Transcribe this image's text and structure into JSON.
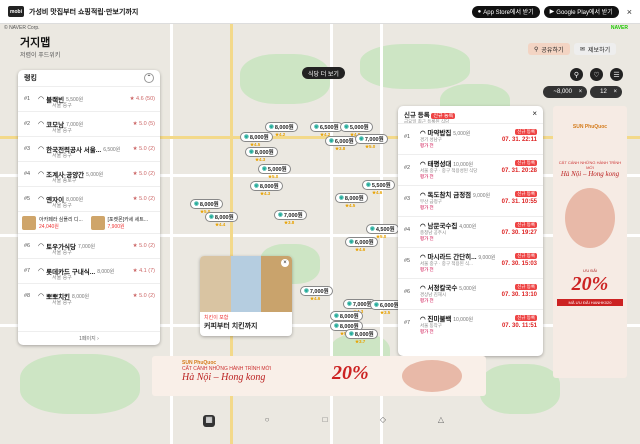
{
  "topbar": {
    "logo": "mobi",
    "promo": "가성비 맛집부터 쇼핑적립·만보기까지",
    "appstore": "App Store에서 받기",
    "googleplay": "Google Play에서 받기",
    "close": "×"
  },
  "header": {
    "copyright": "© NAVER Corp.",
    "naver": "NAVER",
    "title": "거지맵",
    "subtitle": "저렴이 푸드위키",
    "share_label": "공유하기",
    "report_label": "제보하기"
  },
  "map_actions": {
    "view_restaurants": "식당 더 보기",
    "price_filter": "~8,000",
    "count_filter": "12"
  },
  "ranking": {
    "title": "랭킹",
    "items": [
      {
        "rank": "#1",
        "name": "블랙빈",
        "price": "5,500원",
        "addr": "서울 중구",
        "rating": "★ 4.6 (50)"
      },
      {
        "rank": "#2",
        "name": "코모남",
        "price": "7,000원",
        "addr": "서울 중구",
        "rating": "★ 5.0 (5)"
      },
      {
        "rank": "#3",
        "name": "한국전력공사 서울...",
        "price": "6,500원",
        "addr": "서울 중구",
        "rating": "★ 5.0 (2)"
      },
      {
        "rank": "#4",
        "name": "조계사·공양간",
        "price": "5,000원",
        "addr": "서울 종로구",
        "rating": "★ 5.0 (2)"
      },
      {
        "rank": "#5",
        "name": "옌자이",
        "price": "8,000원",
        "addr": "서울 중구",
        "rating": "★ 5.0 (2)"
      },
      {
        "rank": "#6",
        "name": "토우가식당",
        "price": "7,000원",
        "addr": "서울 중구",
        "rating": "★ 5.0 (2)"
      },
      {
        "rank": "#7",
        "name": "롯데카드 구내식...",
        "price": "8,000원",
        "addr": "서울 중구",
        "rating": "★ 4.1 (7)"
      },
      {
        "rank": "#8",
        "name": "뽀뽀치킨",
        "price": "8,000원",
        "addr": "서울 중구",
        "rating": "★ 5.0 (2)"
      }
    ],
    "ads": [
      {
        "name": "아카페라 심플리 디...",
        "price": "24,040원"
      },
      {
        "name": "[포켓몬]카세 세트...",
        "price": "7,900원"
      }
    ],
    "footer": "1페이지"
  },
  "popup": {
    "category": "치킨이 포함",
    "name": "커피부터 치킨까지",
    "close": "×"
  },
  "new_list": {
    "title": "신규 등록",
    "tag": "신규 등록",
    "subtitle": "금요일 최근 등록된 식당",
    "close": "×",
    "items": [
      {
        "num": "#1",
        "name": "마약밥집",
        "price": "5,000원",
        "addr": "경기 성남구",
        "tag": "평가 전",
        "badge": "신규 등록",
        "date": "07. 31. 22:11"
      },
      {
        "num": "#2",
        "name": "태평성대",
        "price": "10,000원",
        "addr": "서울 중구 · 중구 적용성된 식당",
        "tag": "평가 전",
        "badge": "신규 등록",
        "date": "07. 31. 20:28"
      },
      {
        "num": "#3",
        "name": "독도참치 금정점",
        "price": "9,000원",
        "addr": "부산 금정구",
        "tag": "평가 전",
        "badge": "신규 등록",
        "date": "07. 31. 10:55"
      },
      {
        "num": "#4",
        "name": "남문국수집",
        "price": "4,000원",
        "addr": "충청남 공주시",
        "tag": "평가 전",
        "badge": "신규 등록",
        "date": "07. 30. 19:27"
      },
      {
        "num": "#5",
        "name": "마시라드 간단히...",
        "price": "9,000원",
        "addr": "서울 중구 · 중구 적용된 식...",
        "tag": "평가 전",
        "badge": "신규 등록",
        "date": "07. 30. 15:03"
      },
      {
        "num": "#6",
        "name": "서정칼국수",
        "price": "5,000원",
        "addr": "경상남 김해시",
        "tag": "평가 전",
        "badge": "신규 등록",
        "date": "07. 30. 13:10"
      },
      {
        "num": "#7",
        "name": "진미불백",
        "price": "10,000원",
        "addr": "서울 동작구",
        "tag": "평가 전",
        "badge": "신규 등록",
        "date": "07. 30. 11:51"
      }
    ]
  },
  "pins": [
    {
      "label": "8,000원",
      "rating": "★4.2"
    },
    {
      "label": "6,500원",
      "rating": "★4.2"
    },
    {
      "label": "5,000원",
      "rating": "★4.0"
    },
    {
      "label": "8,000원",
      "rating": "★4.5"
    },
    {
      "label": "6,000원",
      "rating": "★3.8"
    },
    {
      "label": "7,000원",
      "rating": "★5.0"
    },
    {
      "label": "8,000원",
      "rating": "★4.3"
    },
    {
      "label": "5,000원",
      "rating": "★5.0"
    },
    {
      "label": "5,500원",
      "rating": "★4.6"
    },
    {
      "label": "8,000원",
      "rating": "★4.3"
    },
    {
      "label": "8,000원",
      "rating": "★5.0"
    },
    {
      "label": "8,000원",
      "rating": "★4.4"
    },
    {
      "label": "8,000원",
      "rating": "★4.5"
    },
    {
      "label": "7,000원",
      "rating": "★3.8"
    },
    {
      "label": "4,500원",
      "rating": "★5.0"
    },
    {
      "label": "6,000원",
      "rating": "★4.6"
    },
    {
      "label": "7,000원",
      "rating": "★4.6"
    },
    {
      "label": "7,000원",
      "rating": "★4.3"
    },
    {
      "label": "6,000원",
      "rating": "★3.5"
    },
    {
      "label": "8,000원",
      "rating": "★5.0"
    },
    {
      "label": "8,000원",
      "rating": "★5.0"
    },
    {
      "label": "8,000원",
      "rating": "★3.7"
    }
  ],
  "ad_right": {
    "brand": "SUN PhuQuoc",
    "tagline": "CẮT CÁNH NHỮNG HÀNH TRÌNH MỚI",
    "route": "Hà Nội – Hong kong",
    "discount_prefix": "ƯU ĐÃI",
    "discount": "20%",
    "cta": "MÃ ƯU ĐÃI HANHK020"
  },
  "ad_bottom": {
    "brand": "SUN PhuQuoc",
    "tagline": "CẤT CÁNH NHỮNG HÀNH TRÌNH MỚI",
    "route": "Hà Nội – Hong kong",
    "discount": "20%"
  },
  "colors": {
    "accent": "#e44444",
    "pin_border": "#888888",
    "title_bg": "#f3d4c3"
  }
}
